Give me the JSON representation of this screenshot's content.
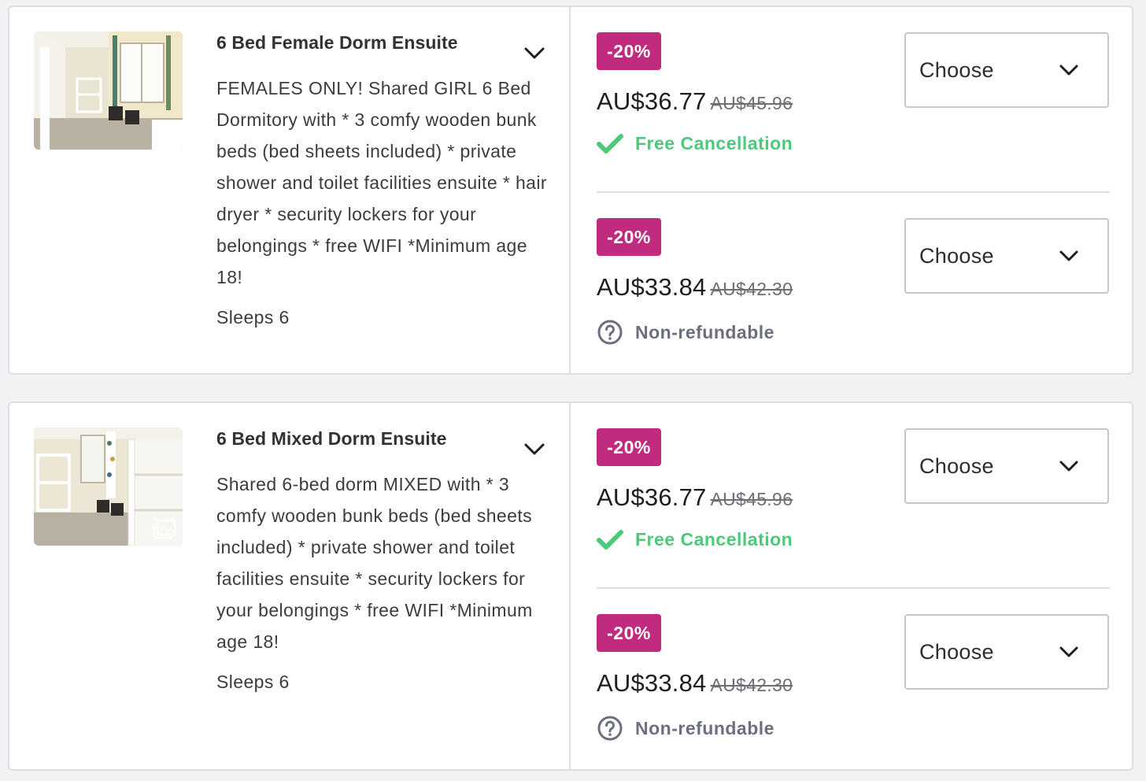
{
  "rooms": [
    {
      "title": "6 Bed Female Dorm Ensuite",
      "description": "FEMALES ONLY! Shared GIRL 6 Bed Dormitory with * 3 comfy wooden bunk beds (bed sheets included) * private shower and toilet facilities ensuite * hair dryer * security lockers for your belongings * free WIFI *Minimum age 18!",
      "sleeps": "Sleeps 6",
      "rates": [
        {
          "discount": "-20%",
          "price": "AU$36.77",
          "old_price": "AU$45.96",
          "policy": "Free Cancellation",
          "select_label": "Choose"
        },
        {
          "discount": "-20%",
          "price": "AU$33.84",
          "old_price": "AU$42.30",
          "policy": "Non-refundable",
          "select_label": "Choose"
        }
      ]
    },
    {
      "title": "6 Bed Mixed Dorm Ensuite",
      "description": "Shared 6-bed dorm MIXED with * 3 comfy wooden bunk beds (bed sheets included) * private shower and toilet facilities ensuite * security lockers for your belongings * free WIFI *Minimum age 18!",
      "sleeps": "Sleeps 6",
      "rates": [
        {
          "discount": "-20%",
          "price": "AU$36.77",
          "old_price": "AU$45.96",
          "policy": "Free Cancellation",
          "select_label": "Choose"
        },
        {
          "discount": "-20%",
          "price": "AU$33.84",
          "old_price": "AU$42.30",
          "policy": "Non-refundable",
          "select_label": "Choose"
        }
      ]
    }
  ],
  "icons": {
    "expand": "chevron-down-icon",
    "select": "chevron-down-icon",
    "free_cancellation": "check-icon",
    "non_refundable": "question-circle-icon",
    "gallery": "gallery-icon"
  },
  "colors": {
    "discount_badge": "#c12b7f",
    "free_cancellation": "#4dc97a",
    "non_refundable": "#6b6f7e",
    "border": "#dddfe4",
    "page_background": "#f1f2f4"
  }
}
